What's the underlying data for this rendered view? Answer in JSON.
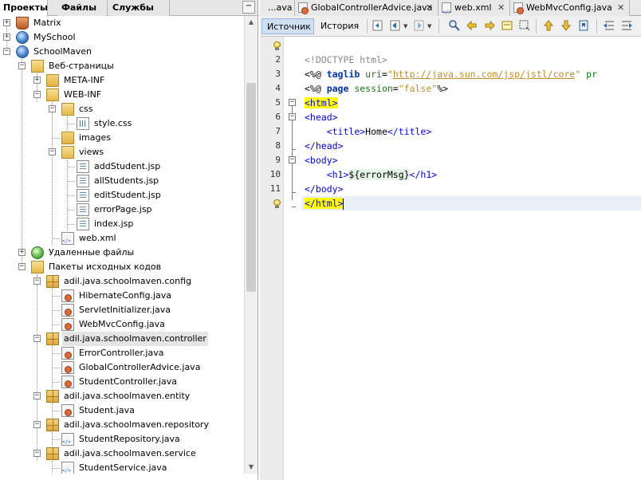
{
  "left_panel": {
    "tabs": [
      {
        "label": "Проекты",
        "active": true
      },
      {
        "label": "Файлы",
        "active": false
      },
      {
        "label": "Службы",
        "active": false
      }
    ],
    "minimize_glyph": "−",
    "tree": [
      {
        "label": "Matrix",
        "icon": "cup-icon"
      },
      {
        "label": "MySchool",
        "icon": "globe-icon"
      },
      {
        "label": "SchoolMaven",
        "icon": "globe-icon"
      },
      {
        "label": "Веб-страницы",
        "icon": "folder-icon"
      },
      {
        "label": "META-INF",
        "icon": "folder-icon"
      },
      {
        "label": "WEB-INF",
        "icon": "folder-icon"
      },
      {
        "label": "css",
        "icon": "folder-icon"
      },
      {
        "label": "style.css",
        "icon": "css-file-icon"
      },
      {
        "label": "images",
        "icon": "folder-icon"
      },
      {
        "label": "views",
        "icon": "folder-icon"
      },
      {
        "label": "addStudent.jsp",
        "icon": "jsp-file-icon"
      },
      {
        "label": "allStudents.jsp",
        "icon": "jsp-file-icon"
      },
      {
        "label": "editStudent.jsp",
        "icon": "jsp-file-icon"
      },
      {
        "label": "errorPage.jsp",
        "icon": "jsp-file-icon"
      },
      {
        "label": "index.jsp",
        "icon": "jsp-file-icon"
      },
      {
        "label": "web.xml",
        "icon": "xml-file-icon"
      },
      {
        "label": "Удаленные файлы",
        "icon": "globe-icon"
      },
      {
        "label": "Пакеты исходных кодов",
        "icon": "folder-icon"
      },
      {
        "label": "adil.java.schoolmaven.config",
        "icon": "package-icon"
      },
      {
        "label": "HibernateConfig.java",
        "icon": "java-file-icon"
      },
      {
        "label": "ServletInitializer.java",
        "icon": "java-file-icon"
      },
      {
        "label": "WebMvcConfig.java",
        "icon": "java-file-icon"
      },
      {
        "label": "adil.java.schoolmaven.controller",
        "icon": "package-icon"
      },
      {
        "label": "ErrorController.java",
        "icon": "java-file-icon"
      },
      {
        "label": "GlobalControllerAdvice.java",
        "icon": "java-file-icon"
      },
      {
        "label": "StudentController.java",
        "icon": "java-file-icon"
      },
      {
        "label": "adil.java.schoolmaven.entity",
        "icon": "package-icon"
      },
      {
        "label": "Student.java",
        "icon": "java-file-icon"
      },
      {
        "label": "adil.java.schoolmaven.repository",
        "icon": "package-icon"
      },
      {
        "label": "StudentRepository.java",
        "icon": "java-file-icon"
      },
      {
        "label": "adil.java.schoolmaven.service",
        "icon": "package-icon"
      },
      {
        "label": "StudentService.java",
        "icon": "java-file-icon"
      }
    ],
    "selected_item": "adil.java.schoolmaven.controller"
  },
  "editor": {
    "tabs": [
      {
        "label": "...ava",
        "icon": "",
        "close": "✕"
      },
      {
        "label": "GlobalControllerAdvice.java",
        "icon": "java-file-icon",
        "close": "✕"
      },
      {
        "label": "web.xml",
        "icon": "xml-file-icon",
        "close": "✕"
      },
      {
        "label": "WebMvcConfig.java",
        "icon": "java-file-icon",
        "close": "✕"
      }
    ],
    "view_buttons": {
      "source": "Источник",
      "history": "История"
    },
    "line_numbers": [
      "2",
      "3",
      "4",
      "5",
      "6",
      "7",
      "8",
      "9",
      "10",
      "11",
      ""
    ],
    "code": {
      "l2_doctype": "<!DOCTYPE html>",
      "l3_open": "<%@ ",
      "l3_kw": "taglib",
      "l3_attr": " uri",
      "l3_eq": "=",
      "l3_q1": "\"",
      "l3_url": "http://java.sun.com/jsp/jstl/core",
      "l3_q2": "\"",
      "l3_attr2": " pr",
      "l4_open": "<%@ ",
      "l4_kw": "page",
      "l4_attr": " session",
      "l4_eq": "=",
      "l4_val": "\"false\"",
      "l4_close": "%>",
      "l5": "<html>",
      "l6": "<head>",
      "l7_indent": "    ",
      "l7_open": "<title>",
      "l7_text": "Home",
      "l7_close": "</title>",
      "l8": "</head>",
      "l9": "<body>",
      "l10_indent": "    ",
      "l10_open": "<h1>",
      "l10_el": "${errorMsg}",
      "l10_close": "</h1>",
      "l11": "</body>",
      "l12": "</html>"
    }
  }
}
